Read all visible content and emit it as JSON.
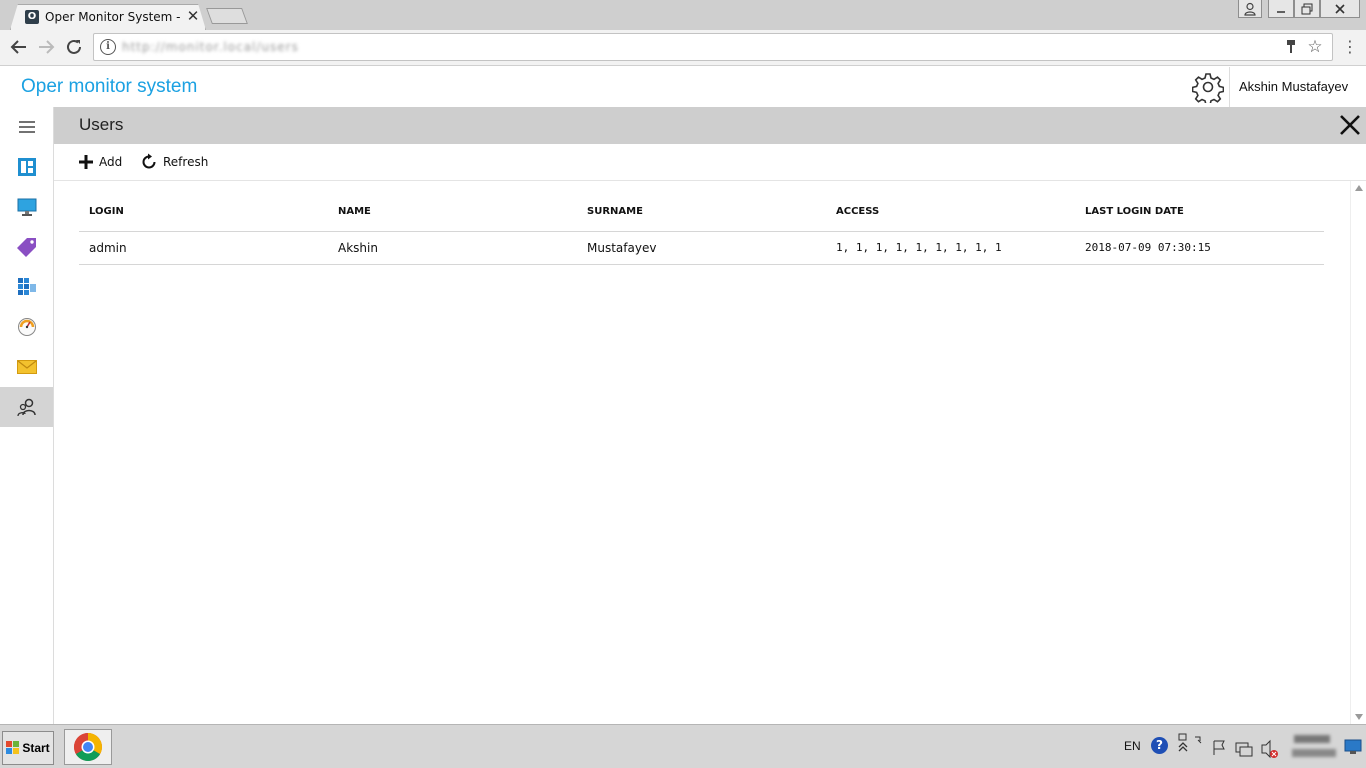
{
  "browser": {
    "tab_title": "Oper Monitor System - Port",
    "tab_favicon_letter": "O",
    "tab_close": "✕",
    "url": "http://monitor.local/users",
    "icons": [
      "back-icon",
      "forward-icon",
      "reload-icon",
      "info-icon",
      "key-icon",
      "star-icon",
      "menu-icon"
    ]
  },
  "window_controls": {
    "user": "⍝",
    "minimize": "▁",
    "maximize": "❐",
    "close": "✕"
  },
  "app": {
    "title": "Oper monitor system",
    "user_name": "Akshin Mustafayev",
    "accent_color": "#1ba1e2"
  },
  "sidebar": {
    "items": [
      {
        "icon": "hamburger-icon",
        "active": false
      },
      {
        "icon": "dashboard-icon",
        "active": false
      },
      {
        "icon": "monitor-icon",
        "active": false
      },
      {
        "icon": "tag-icon",
        "active": false
      },
      {
        "icon": "tiles-icon",
        "active": false
      },
      {
        "icon": "gauge-icon",
        "active": false
      },
      {
        "icon": "mail-icon",
        "active": false
      },
      {
        "icon": "users-icon",
        "active": true
      }
    ]
  },
  "panel": {
    "title": "Users",
    "actions": {
      "add_label": "Add",
      "refresh_label": "Refresh"
    }
  },
  "table": {
    "columns": [
      "LOGIN",
      "NAME",
      "SURNAME",
      "ACCESS",
      "LAST LOGIN DATE"
    ],
    "rows": [
      [
        "admin",
        "Akshin",
        "Mustafayev",
        "1, 1, 1, 1, 1, 1, 1, 1, 1",
        "2018-07-09 07:30:15"
      ]
    ]
  },
  "taskbar": {
    "start_label": "Start",
    "language": "EN",
    "help_symbol": "?"
  }
}
